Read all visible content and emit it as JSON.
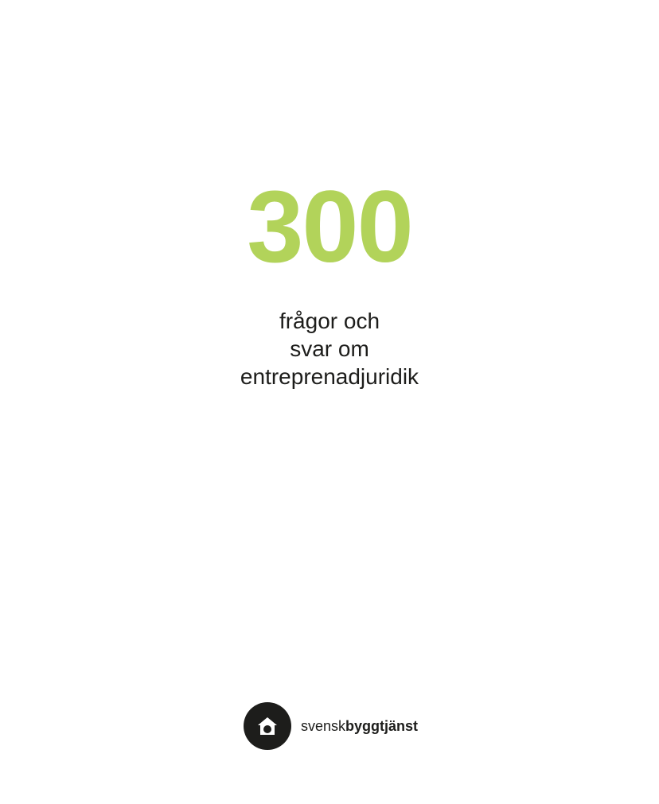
{
  "cover": {
    "number": "300",
    "number_color": "#b2d35a",
    "subtitle_lines": [
      "frågor och",
      "svar om",
      "entreprenadjuridik"
    ]
  },
  "logo": {
    "icon": "house-icon",
    "text_light": "svensk",
    "text_bold": "byggtjänst"
  }
}
